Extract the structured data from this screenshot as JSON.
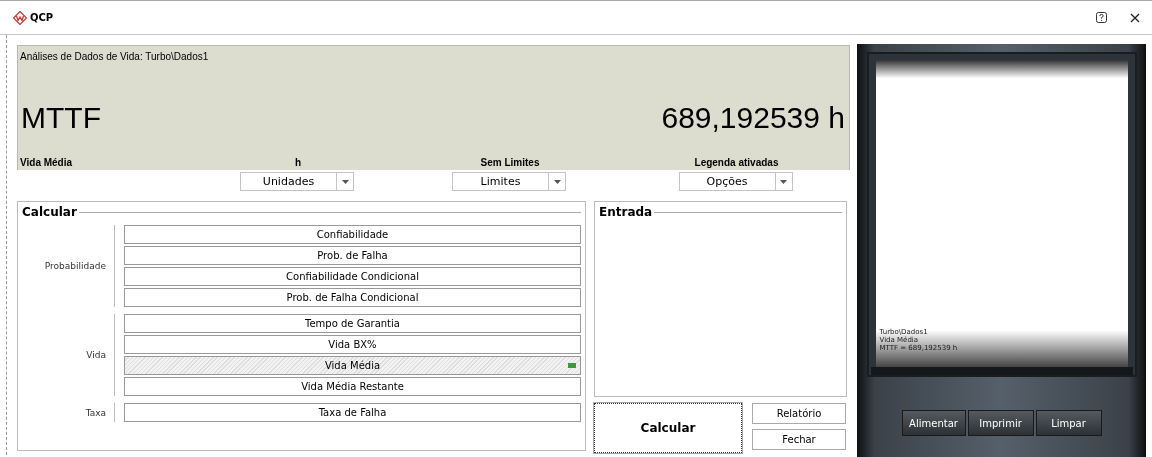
{
  "window": {
    "title": "QCP"
  },
  "display": {
    "header": "Análises de Dados de Vida: Turbo\\Dados1",
    "metric": "MTTF",
    "value": "689,192539 h",
    "footer": [
      "Vida Média",
      "h",
      "Sem Limites",
      "Legenda ativadas"
    ]
  },
  "dropdowns": [
    {
      "label": "Unidades"
    },
    {
      "label": "Limites"
    },
    {
      "label": "Opções"
    }
  ],
  "calculate": {
    "title": "Calcular",
    "groups": [
      {
        "label": "Probabilidade",
        "buttons": [
          {
            "label": "Confiabilidade",
            "selected": false
          },
          {
            "label": "Prob. de Falha",
            "selected": false
          },
          {
            "label": "Confiabilidade Condicional",
            "selected": false
          },
          {
            "label": "Prob. de Falha Condicional",
            "selected": false
          }
        ]
      },
      {
        "label": "Vida",
        "buttons": [
          {
            "label": "Tempo de Garantia",
            "selected": false
          },
          {
            "label": "Vida BX%",
            "selected": false
          },
          {
            "label": "Vida Média",
            "selected": true
          },
          {
            "label": "Vida Média Restante",
            "selected": false
          }
        ]
      },
      {
        "label": "Taxa",
        "buttons": [
          {
            "label": "Taxa de Falha",
            "selected": false
          }
        ]
      }
    ]
  },
  "input": {
    "title": "Entrada"
  },
  "actions": {
    "primary": "Calcular",
    "secondary": [
      "Relatório",
      "Fechar"
    ]
  },
  "printer": {
    "lines": [
      "Turbo\\Dados1",
      "Vida Média",
      "MTTF = 689,192539 h"
    ],
    "buttons": [
      "Alimentar",
      "Imprimir",
      "Limpar"
    ]
  }
}
